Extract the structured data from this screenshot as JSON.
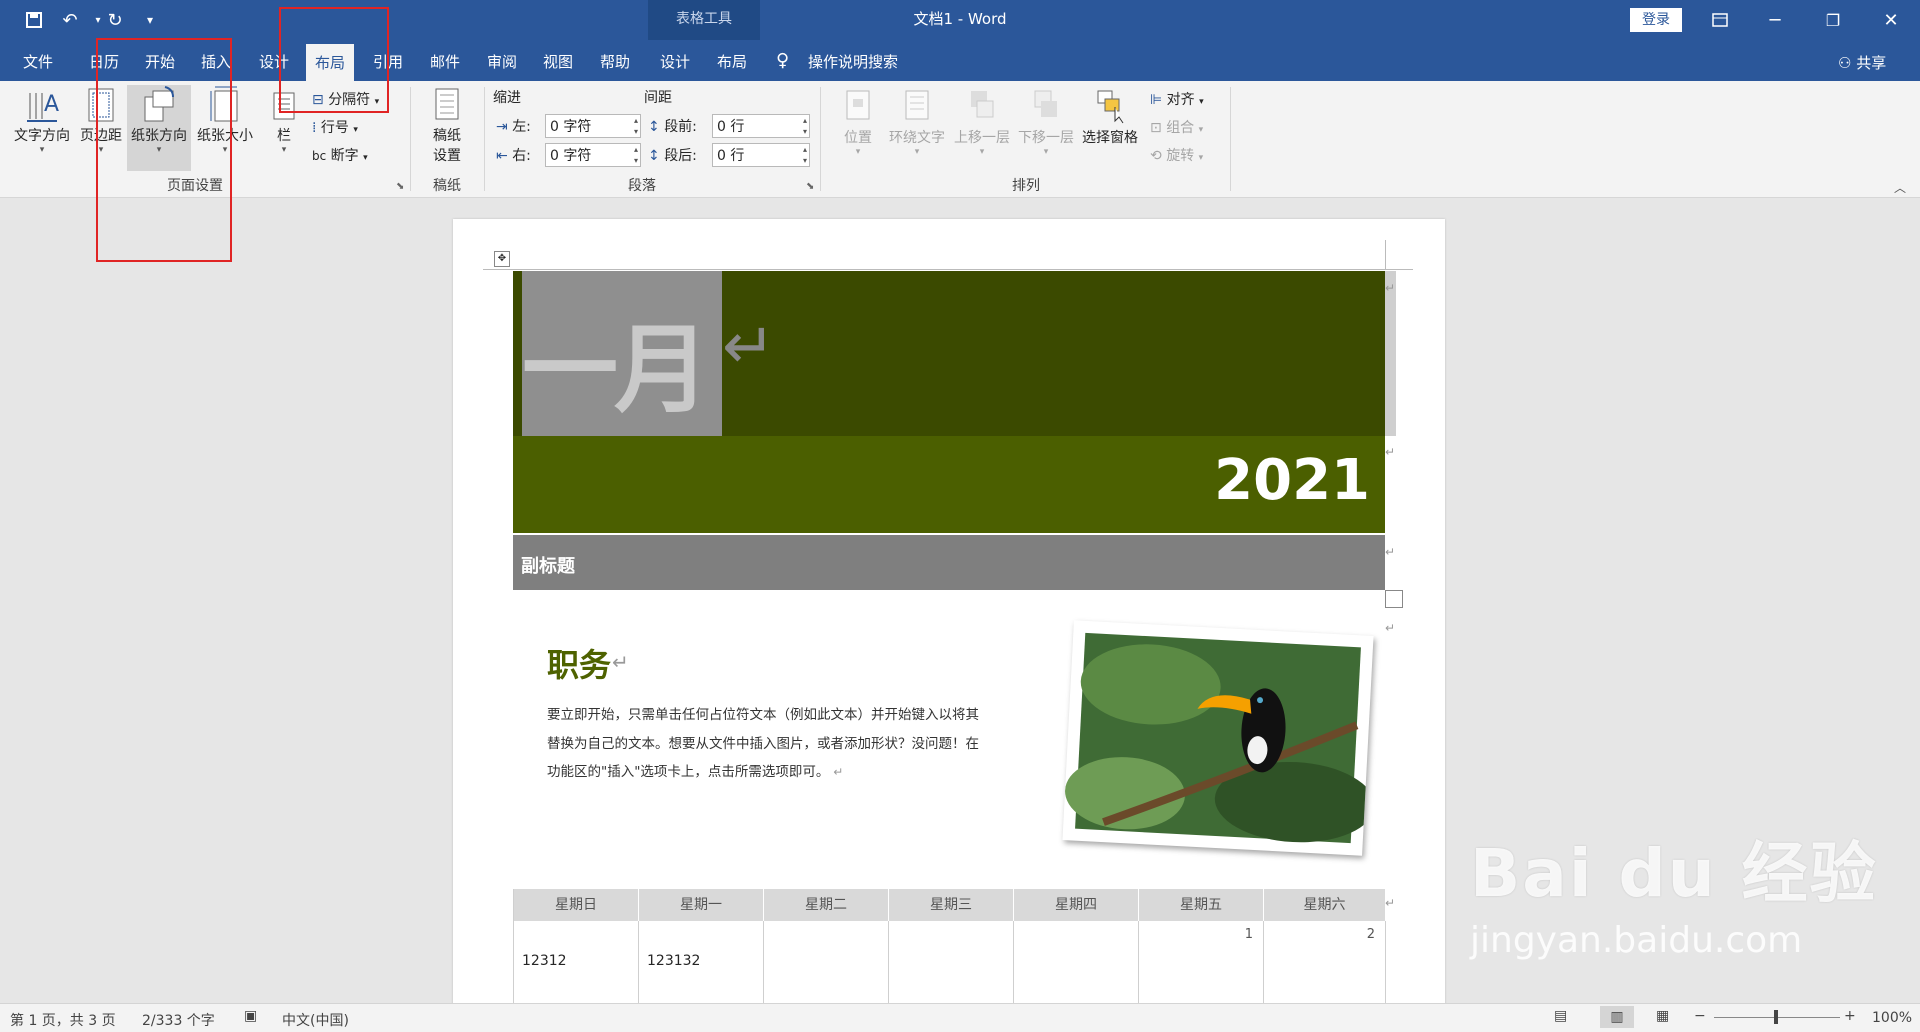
{
  "titlebar": {
    "context_tab_group": "表格工具",
    "document_title": "文档1  -  Word",
    "login_label": "登录"
  },
  "tabs": [
    "文件",
    "日历",
    "开始",
    "插入",
    "设计",
    "布局",
    "引用",
    "邮件",
    "审阅",
    "视图",
    "帮助",
    "设计",
    "布局"
  ],
  "active_tab": "布局",
  "tell_me": "操作说明搜索",
  "share_label": "共享",
  "ribbon": {
    "page_setup": {
      "text_direction": "文字方向",
      "margins": "页边距",
      "orientation": "纸张方向",
      "size": "纸张大小",
      "columns": "栏",
      "breaks": "分隔符",
      "line_numbers": "行号",
      "hyphenation": "断字",
      "group_label": "页面设置"
    },
    "draft_paper": {
      "button": "稿纸",
      "button2": "设置",
      "group_label": "稿纸"
    },
    "paragraph": {
      "indent_title": "缩进",
      "spacing_title": "间距",
      "left_label": "左:",
      "left_value": "0 字符",
      "right_label": "右:",
      "right_value": "0 字符",
      "before_label": "段前:",
      "before_value": "0 行",
      "after_label": "段后:",
      "after_value": "0 行",
      "group_label": "段落"
    },
    "arrange": {
      "position": "位置",
      "wrap_text": "环绕文字",
      "bring_forward": "上移一层",
      "send_backward": "下移一层",
      "selection_pane": "选择窗格",
      "align": "对齐",
      "group": "组合",
      "rotate": "旋转",
      "group_label": "排列"
    }
  },
  "document": {
    "month": "一月",
    "year": "2021",
    "subtitle": "副标题",
    "section_heading": "职务",
    "body_lines": [
      "要立即开始，只需单击任何占位符文本（例如此文本）并开始键入以将其",
      "替换为自己的文本。想要从文件中插入图片，或者添加形状？没问题！在",
      "功能区的\"插入\"选项卡上，点击所需选项即可。"
    ],
    "weekdays": [
      "星期日",
      "星期一",
      "星期二",
      "星期三",
      "星期四",
      "星期五",
      "星期六"
    ],
    "week1_numbers": [
      "",
      "",
      "",
      "",
      "",
      "1",
      "2"
    ],
    "week1_notes": [
      "12312",
      "123132",
      "",
      "",
      "",
      "",
      ""
    ]
  },
  "statusbar": {
    "page": "第 1 页，共 3 页",
    "words": "2/333 个字",
    "language": "中文(中国)",
    "zoom": "100%"
  },
  "watermark": {
    "brand": "Bai du 经验",
    "url": "jingyan.baidu.com"
  },
  "colors": {
    "brand_blue": "#2b579a",
    "banner_dark": "#3b4a00",
    "banner_light": "#4b5f00",
    "subtitle_bar": "#7f7f7f",
    "heading_green": "#4e6200"
  }
}
